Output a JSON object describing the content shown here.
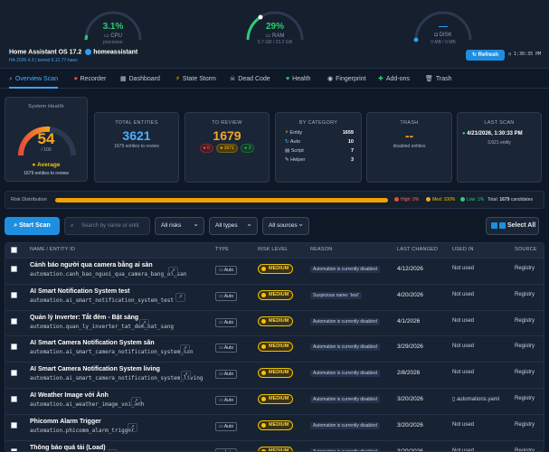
{
  "header": {
    "gauges": [
      {
        "value": "3.1%",
        "label": "CPU",
        "sub": "processor",
        "color": "#2ecc71",
        "pct": 0.031
      },
      {
        "value": "29%",
        "label": "RAM",
        "sub": "6.7 GB / 23.2 GB",
        "color": "#2ecc71",
        "pct": 0.29
      },
      {
        "value": "—",
        "label": "DISK",
        "sub": "0 MB / 0 MB",
        "color": "#2aa0f0",
        "pct": 0
      }
    ],
    "host": "Home Assistant OS 17.2",
    "hostname": "homeassistant",
    "version": "HA 2026.4.3 | kernel 6.12.77-haos",
    "refresh_label": "Refresh",
    "time": "1:30:35 PM"
  },
  "tabs": [
    {
      "icon": "⌕",
      "label": "Overview Scan"
    },
    {
      "icon": "⏺",
      "label": "Recorder"
    },
    {
      "icon": "▦",
      "label": "Dashboard"
    },
    {
      "icon": "⚡",
      "label": "State Storm"
    },
    {
      "icon": "☠",
      "label": "Dead Code"
    },
    {
      "icon": "♥",
      "label": "Health"
    },
    {
      "icon": "◉",
      "label": "Fingerprint"
    },
    {
      "icon": "✚",
      "label": "Add-ons"
    },
    {
      "icon": "🗑",
      "label": "Trash"
    }
  ],
  "health": {
    "title": "System Health",
    "score": "54",
    "of": "/ 100",
    "grade": "Average",
    "note": "1679 entities to review",
    "pct": 0.54
  },
  "cards": {
    "total": {
      "title": "TOTAL ENTITIES",
      "value": "3621",
      "sub": "1679 entities to review"
    },
    "review": {
      "title": "TO REVIEW",
      "value": "1679",
      "high": "0",
      "med": "1671",
      "low": "3"
    },
    "category": {
      "title": "BY CATEGORY",
      "items": [
        {
          "icon": "⚡",
          "label": "Entity",
          "value": "1659"
        },
        {
          "icon": "↻",
          "label": "Auto",
          "value": "10"
        },
        {
          "icon": "▤",
          "label": "Script",
          "value": "7"
        },
        {
          "icon": "✎",
          "label": "Helper",
          "value": "3"
        }
      ]
    },
    "trash": {
      "title": "TRASH",
      "value": "--",
      "sub": "disabled entities"
    },
    "last": {
      "title": "LAST SCAN",
      "value": "4/21/2026, 1:30:33 PM",
      "sub": "3,621 entity"
    }
  },
  "risk": {
    "label": "Risk Distribution",
    "high": "High: 0%",
    "med": "Med: 100%",
    "low": "Low: 1%",
    "total_prefix": "Total:",
    "total": "1679",
    "total_suffix": "candidates"
  },
  "controls": {
    "scan": "Start Scan",
    "search_placeholder": "Search by name or entit",
    "risks": "All risks",
    "types": "All types",
    "sources": "All sources",
    "select_all": "Select All"
  },
  "table": {
    "headers": [
      "NAME / ENTITY ID",
      "TYPE",
      "RISK LEVEL",
      "REASON",
      "LAST CHANGED",
      "USED IN",
      "SOURCE"
    ],
    "rows": [
      {
        "name": "Cảnh báo người qua camera bằng ai sàn",
        "id": "automation.canh_bao_nguoi_qua_camera_bang_ai_san",
        "type": "Auto",
        "risk": "MEDIUM",
        "reason": "Automation is currently disabled",
        "date": "4/12/2026",
        "used": "Not used",
        "source": "Registry"
      },
      {
        "name": "AI Smart Notification System test",
        "id": "automation.ai_smart_notification_system_test",
        "type": "Auto",
        "risk": "MEDIUM",
        "reason": "Suspicious name: 'test'",
        "date": "4/20/2026",
        "used": "Not used",
        "source": "Registry"
      },
      {
        "name": "Quản lý Inverter: Tắt đèm - Bật sáng",
        "id": "automation.quan_ly_inverter_tat_dem_bat_sang",
        "type": "Auto",
        "risk": "MEDIUM",
        "reason": "Automation is currently disabled",
        "date": "4/1/2026",
        "used": "Not used",
        "source": "Registry"
      },
      {
        "name": "AI Smart Camera Notification System sân",
        "id": "automation.ai_smart_camera_notification_system_san",
        "type": "Auto",
        "risk": "MEDIUM",
        "reason": "Automation is currently disabled",
        "date": "3/29/2026",
        "used": "Not used",
        "source": "Registry"
      },
      {
        "name": "AI Smart Camera Notification System living",
        "id": "automation.ai_smart_camera_notification_system_living",
        "type": "Auto",
        "risk": "MEDIUM",
        "reason": "Automation is currently disabled",
        "date": "2/8/2026",
        "used": "Not used",
        "source": "Registry"
      },
      {
        "name": "AI Weather Image với Ảnh",
        "id": "automation.ai_weather_image_voi_anh",
        "type": "Auto",
        "risk": "MEDIUM",
        "reason": "Automation is currently disabled",
        "date": "3/20/2026",
        "used": "automations.yaml",
        "source": "Registry"
      },
      {
        "name": "Phicomm Alarm Trigger",
        "id": "automation.phicomm_alarm_trigger",
        "type": "Auto",
        "risk": "MEDIUM",
        "reason": "Automation is currently disabled",
        "date": "3/20/2026",
        "used": "Not used",
        "source": "Registry"
      },
      {
        "name": "Thông báo quá tải (Load)",
        "id": "automation.thong_bao_qua_tai_load",
        "type": "Auto",
        "risk": "MEDIUM",
        "reason": "Automation is currently disabled",
        "date": "3/20/2026",
        "used": "Not used",
        "source": "Registry"
      }
    ]
  }
}
